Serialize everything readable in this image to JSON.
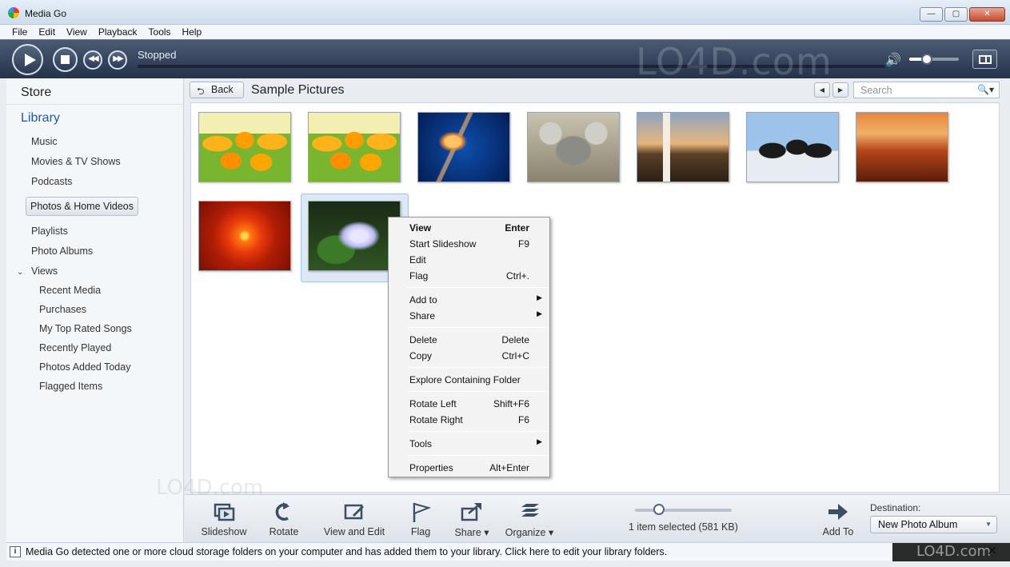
{
  "window": {
    "title": "Media Go",
    "minimize": "—",
    "maximize": "▢",
    "close": "✕"
  },
  "menubar": [
    "File",
    "Edit",
    "View",
    "Playback",
    "Tools",
    "Help"
  ],
  "transport": {
    "status": "Stopped",
    "watermark": "LO4D.com",
    "volume": 0.35
  },
  "sidebar": {
    "store": "Store",
    "library": "Library",
    "items": {
      "music": "Music",
      "movies": "Movies & TV Shows",
      "podcasts": "Podcasts",
      "photos": "Photos & Home Videos",
      "playlists": "Playlists",
      "albums": "Photo Albums",
      "views": "Views",
      "recent": "Recent Media",
      "purchases": "Purchases",
      "top_rated": "My Top Rated Songs",
      "recently_played": "Recently Played",
      "photos_today": "Photos Added Today",
      "flagged": "Flagged Items"
    }
  },
  "header": {
    "back": "Back",
    "breadcrumb": "Sample Pictures",
    "search_placeholder": "Search"
  },
  "thumbnails": [
    "Tulips",
    "Tulips",
    "Jellyfish",
    "Koala",
    "Lighthouse",
    "Penguins",
    "Desert",
    "Chrysanthemum",
    "Hydrangeas"
  ],
  "context_menu": [
    {
      "label": "View",
      "shortcut": "Enter"
    },
    {
      "label": "Start Slideshow",
      "shortcut": "F9"
    },
    {
      "label": "Edit",
      "shortcut": ""
    },
    {
      "label": "Flag",
      "shortcut": "Ctrl+."
    },
    {
      "label": "Add to",
      "shortcut": ""
    },
    {
      "label": "Share",
      "shortcut": ""
    },
    {
      "label": "Delete",
      "shortcut": "Delete"
    },
    {
      "label": "Copy",
      "shortcut": "Ctrl+C"
    },
    {
      "label": "Explore Containing Folder",
      "shortcut": ""
    },
    {
      "label": "Rotate Left",
      "shortcut": "Shift+F6"
    },
    {
      "label": "Rotate Right",
      "shortcut": "F6"
    },
    {
      "label": "Tools",
      "shortcut": ""
    },
    {
      "label": "Properties",
      "shortcut": "Alt+Enter"
    }
  ],
  "toolbar": {
    "slideshow": "Slideshow",
    "rotate": "Rotate",
    "view_edit": "View and Edit",
    "flag": "Flag",
    "share": "Share ▾",
    "organize": "Organize ▾",
    "selection": "1 item selected (581 KB)",
    "add_to": "Add To",
    "destination_label": "Destination:",
    "destination_value": "New Photo Album",
    "zoom": 0.25
  },
  "statusbar": {
    "message": "Media Go detected one or more cloud storage folders on your computer and has added them to your library. Click here to edit your library folders.",
    "close": "✕",
    "watermark": "LO4D.com"
  }
}
